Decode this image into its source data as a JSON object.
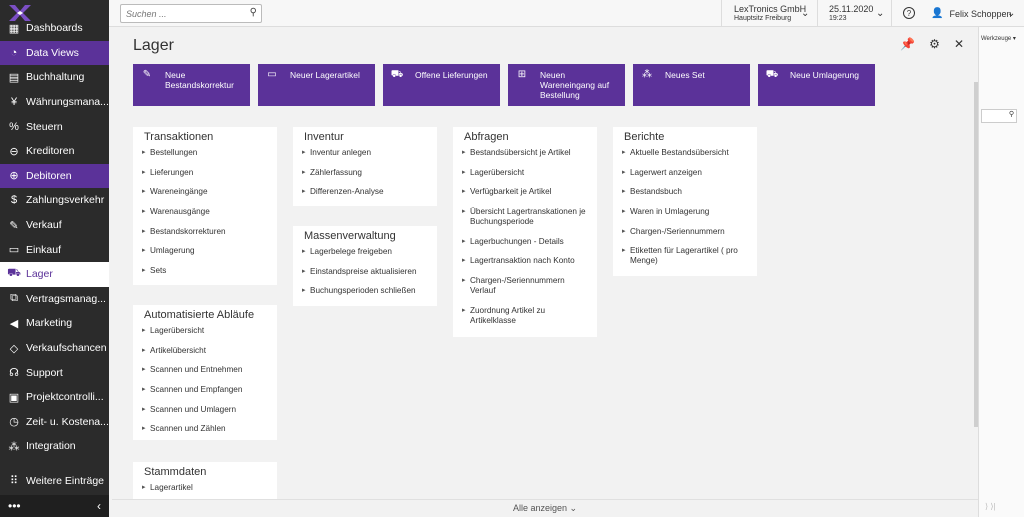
{
  "topbar": {
    "search_placeholder": "Suchen ...",
    "company": "LexTronics GmbH",
    "company_sub": "Hauptsitz Freiburg",
    "date": "25.11.2020",
    "time": "19:23",
    "help": "?",
    "user": "Felix Schoppen"
  },
  "sidebar": {
    "items": [
      {
        "label": "Dashboards",
        "icon": "dashboard-icon"
      },
      {
        "label": "Data Views",
        "icon": "pie-chart-icon"
      },
      {
        "label": "Buchhaltung",
        "icon": "ledger-icon"
      },
      {
        "label": "Währungsmana...",
        "icon": "currency-icon"
      },
      {
        "label": "Steuern",
        "icon": "percent-icon"
      },
      {
        "label": "Kreditoren",
        "icon": "minus-circle-icon"
      },
      {
        "label": "Debitoren",
        "icon": "plus-circle-icon"
      },
      {
        "label": "Zahlungsverkehr",
        "icon": "dollar-icon"
      },
      {
        "label": "Verkauf",
        "icon": "edit-icon"
      },
      {
        "label": "Einkauf",
        "icon": "cart-icon"
      },
      {
        "label": "Lager",
        "icon": "truck-icon"
      },
      {
        "label": "Vertragsmanag...",
        "icon": "handshake-icon"
      },
      {
        "label": "Marketing",
        "icon": "megaphone-icon"
      },
      {
        "label": "Verkaufschancen",
        "icon": "tag-icon"
      },
      {
        "label": "Support",
        "icon": "headset-icon"
      },
      {
        "label": "Projektcontrolli...",
        "icon": "projects-icon"
      },
      {
        "label": "Zeit- u. Kostena...",
        "icon": "stopwatch-icon"
      },
      {
        "label": "Integration",
        "icon": "integration-icon"
      },
      {
        "label": "Weitere Einträge",
        "icon": "grid-icon"
      }
    ],
    "bottom_dots": "•••",
    "bottom_chevron": "‹"
  },
  "background": {
    "tools_label": "Werkzeuge ▾",
    "pager": "⟩  ⟩|"
  },
  "modal": {
    "title": "Lager",
    "footer": "Alle anzeigen",
    "actions": [
      {
        "label": "Neue Bestandskorrektur",
        "icon": "edit-icon"
      },
      {
        "label": "Neuer Lagerartikel",
        "icon": "briefcase-icon"
      },
      {
        "label": "Offene Lieferungen",
        "icon": "truck-icon"
      },
      {
        "label": "Neuen Wareneingang auf Bestellung",
        "icon": "cart-icon"
      },
      {
        "label": "Neues Set",
        "icon": "set-icon"
      },
      {
        "label": "Neue Umlagerung",
        "icon": "truck-icon"
      }
    ],
    "sections": {
      "transaktionen": {
        "title": "Transaktionen",
        "items": [
          "Bestellungen",
          "Lieferungen",
          "Wareneingänge",
          "Warenausgänge",
          "Bestandskorrekturen",
          "Umlagerung",
          "Sets"
        ]
      },
      "automatisierte": {
        "title": "Automatisierte Abläufe",
        "items": [
          "Lagerübersicht",
          "Artikelübersicht",
          "Scannen und Entnehmen",
          "Scannen und Empfangen",
          "Scannen und Umlagern",
          "Scannen und Zählen"
        ]
      },
      "stammdaten": {
        "title": "Stammdaten",
        "items": [
          "Lagerartikel"
        ]
      },
      "inventur": {
        "title": "Inventur",
        "items": [
          "Inventur anlegen",
          "Zählerfassung",
          "Differenzen-Analyse"
        ]
      },
      "massenverwaltung": {
        "title": "Massenverwaltung",
        "items": [
          "Lagerbelege freigeben",
          "Einstandspreise aktualisieren",
          "Buchungsperioden schließen"
        ]
      },
      "abfragen": {
        "title": "Abfragen",
        "items": [
          "Bestandsübersicht je Artikel",
          "Lagerübersicht",
          "Verfügbarkeit je Artikel",
          "Übersicht Lagertranskationen je Buchungsperiode",
          "Lagerbuchungen - Details",
          "Lagertransaktion nach Konto",
          "Chargen-/Seriennummern Verlauf",
          "Zuordnung Artikel zu Artikelklasse"
        ]
      },
      "berichte": {
        "title": "Berichte",
        "items": [
          "Aktuelle Bestandsübersicht",
          "Lagerwert anzeigen",
          "Bestandsbuch",
          "Waren in Umlagerung",
          "Chargen-/Seriennummern",
          "Etiketten für Lagerartikel ( pro Menge)"
        ]
      }
    }
  },
  "colors": {
    "accent": "#5b3299",
    "sidebar_bg": "#2b2b2b"
  }
}
